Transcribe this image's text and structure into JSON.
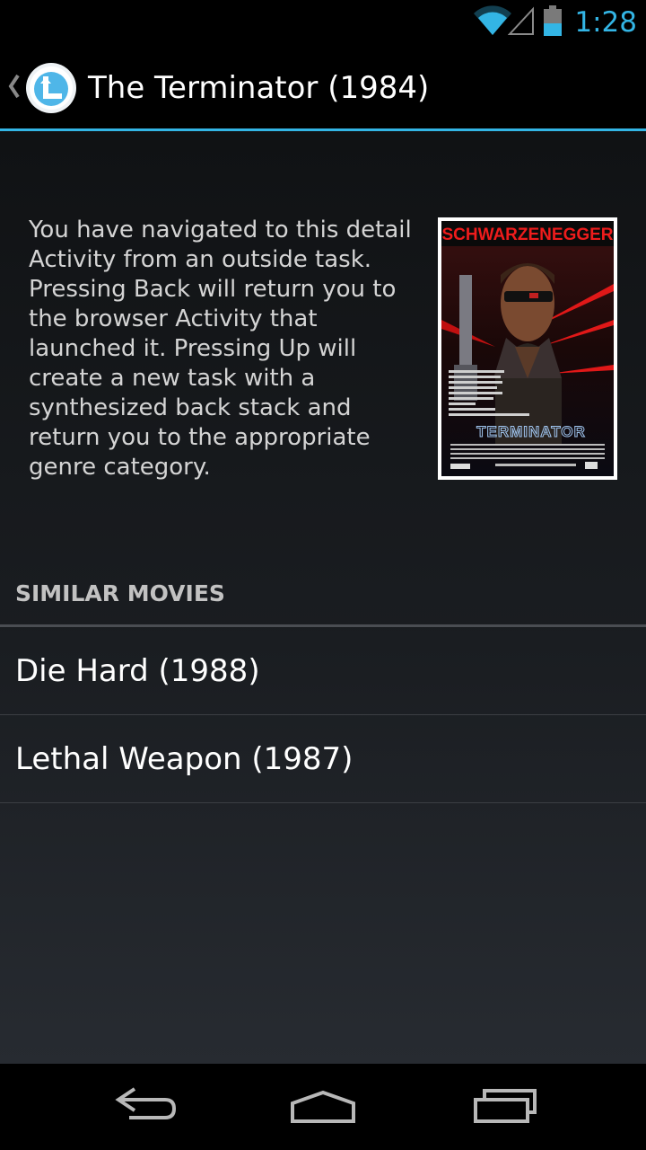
{
  "status_bar": {
    "time": "1:28",
    "icons": [
      "wifi-icon",
      "cell-signal-icon",
      "battery-icon"
    ],
    "accent_color": "#33b5e5"
  },
  "action_bar": {
    "title": "The Terminator (1984)",
    "up_icon": "chevron-left-icon",
    "app_icon": "app-logo-icon"
  },
  "detail": {
    "description": "You have navigated to this detail Activity from an outside task. Pressing Back will return you to the browser Activity that launched it. Pressing Up will create a new task with a synthesized back stack and return you to the appropriate genre category.",
    "poster": {
      "headline": "SCHWARZENEGGER",
      "title_art": "TERMINATOR"
    }
  },
  "similar": {
    "header": "SIMILAR MOVIES",
    "items": [
      {
        "label": "Die Hard (1988)"
      },
      {
        "label": "Lethal Weapon (1987)"
      }
    ]
  },
  "nav_bar": {
    "buttons": [
      "back-icon",
      "home-icon",
      "recents-icon"
    ]
  }
}
